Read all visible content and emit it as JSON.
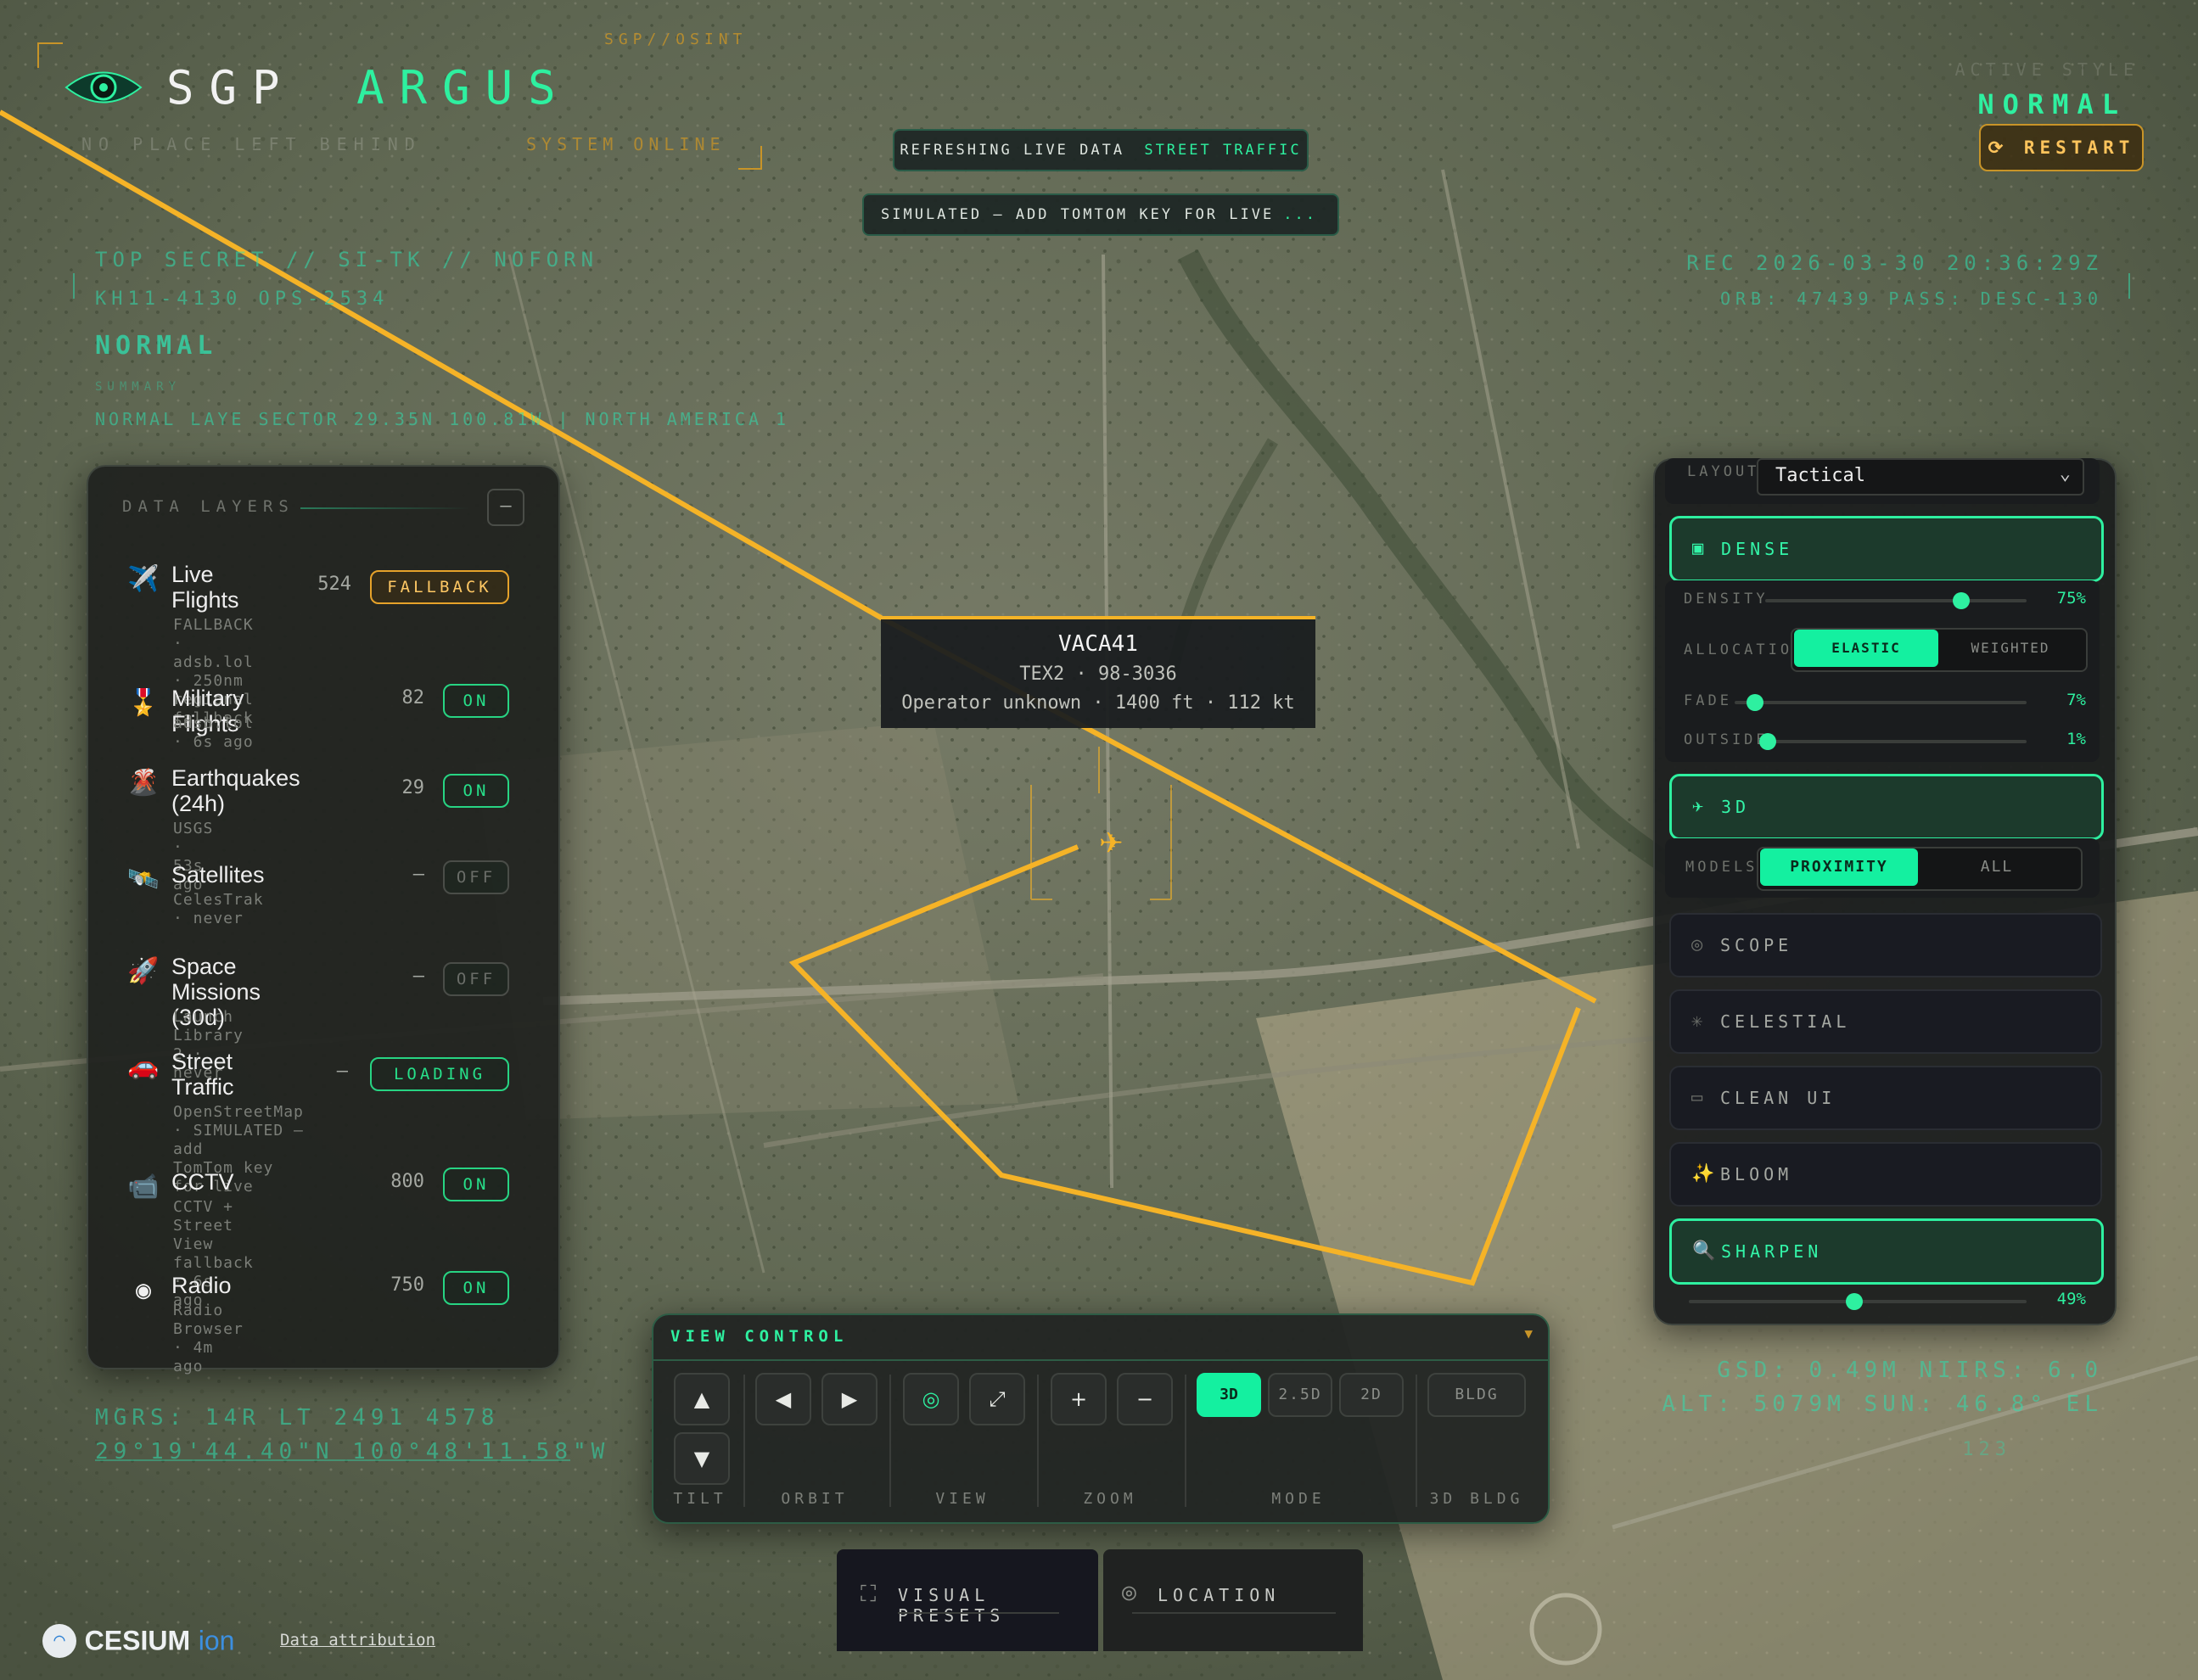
{
  "app": {
    "brand_left": "SGP",
    "brand_right": "ARGUS",
    "top_center_tag": "SGP//OSINT",
    "subtitle_faded": "NO PLACE LEFT BEHIND",
    "system_status": "SYSTEM ONLINE"
  },
  "status_right": {
    "faded_label": "ACTIVE STYLE",
    "mode": "NORMAL",
    "restart_label": "RESTART"
  },
  "banners": {
    "refresh_prefix": "REFRESHING LIVE DATA",
    "refresh_highlight": "STREET TRAFFIC",
    "simulated_text": "SIMULATED — ADD TOMTOM KEY FOR LIVE",
    "simulated_dots": "..."
  },
  "hud": {
    "classification": "TOP SECRET // SI-TK // NOFORN",
    "kh_line": "KH11-4130 OPS-2534",
    "mode": "NORMAL",
    "summary_label": "SUMMARY",
    "sector_line": "NORMAL LAYE SECTOR 29.35N 100.81W | NORTH AMERICA 1",
    "rec_line": "REC 2026-03-30 20:36:29Z",
    "orb_line": "ORB: 47439 PASS: DESC-130",
    "mgrs_line": "MGRS: 14R LT 2491 4578",
    "coords_line": "29°19'44.40\"N 100°48'11.58\"W",
    "gsd_line": "GSD: 0.49M NIIRS: 6.0",
    "alt_line": "ALT: 5079M SUN: 46.8° EL",
    "small_right": "123"
  },
  "data_layers": {
    "title": "DATA LAYERS",
    "collapse_label": "–",
    "items": [
      {
        "icon": "✈️",
        "name": "Live\nFlights",
        "count": "524",
        "state": "FALLBACK",
        "sub": "FALLBACK · adsb.lol · 250nm\nregional fallback"
      },
      {
        "icon": "🎖️",
        "name": "Military Flights",
        "count": "82",
        "state": "ON",
        "sub": "adsb.lol · 6s ago"
      },
      {
        "icon": "🌋",
        "name": "Earthquakes\n(24h)",
        "count": "29",
        "state": "ON",
        "sub": "USGS · 53s ago"
      },
      {
        "icon": "🛰️",
        "name": "Satellites",
        "count": "—",
        "state": "OFF",
        "sub": "CelesTrak · never"
      },
      {
        "icon": "🚀",
        "name": "Space Missions\n(30d)",
        "count": "—",
        "state": "OFF",
        "sub": "Launch Library 2 · never"
      },
      {
        "icon": "🚗",
        "name": "Street\nTraffic",
        "count": "—",
        "state": "LOADING",
        "sub": "OpenStreetMap · SIMULATED — add\nTomTom key for live"
      },
      {
        "icon": "📹",
        "name": "CCTV",
        "count": "800",
        "state": "ON",
        "sub": "CCTV + Street View fallback · 6s\nago"
      },
      {
        "icon": "◉",
        "name": "Radio",
        "count": "750",
        "state": "ON",
        "sub": "Radio Browser · 4m ago"
      }
    ]
  },
  "tooltip": {
    "callsign": "VACA41",
    "reg_line": "TEX2 · 98-3036",
    "detail_line": "Operator unknown · 1400 ft · 112 kt"
  },
  "right_panel": {
    "layout_label": "LAYOUT",
    "layout_value": "Tactical",
    "dense_label": "DENSE",
    "density_label": "DENSITY",
    "density_value": "75%",
    "density": 0.75,
    "allocation_label": "ALLOCATION",
    "allocation_options": [
      "ELASTIC",
      "WEIGHTED"
    ],
    "allocation_selected": "ELASTIC",
    "fade_label": "FADE",
    "fade_value": "7%",
    "fade": 0.07,
    "outside_label": "OUTSIDE",
    "outside_value": "1%",
    "outside": 0.01,
    "three_d_label": "3D",
    "models_label": "MODELS",
    "models_options": [
      "PROXIMITY",
      "ALL"
    ],
    "models_selected": "PROXIMITY",
    "scope_label": "SCOPE",
    "celestial_label": "CELESTIAL",
    "clean_ui_label": "CLEAN UI",
    "bloom_label": "BLOOM",
    "sharpen_label": "SHARPEN",
    "sharpen_value": "49%",
    "sharpen": 0.49
  },
  "view_control": {
    "title": "VIEW CONTROL",
    "groups": {
      "tilt": "TILT",
      "orbit": "ORBIT",
      "view": "VIEW",
      "zoom": "ZOOM",
      "mode": "MODE",
      "bldg": "3D BLDG"
    },
    "mode_options": [
      "3D",
      "2.5D",
      "2D"
    ],
    "mode_selected": "3D",
    "bldg_label": "BLDG"
  },
  "bottom_tabs": {
    "visual_presets": "VISUAL PRESETS",
    "location": "LOCATION"
  },
  "attribution": {
    "cesium": "CESIUM",
    "ion": "ion",
    "link": "Data attribution"
  },
  "colors": {
    "accent_green": "#2ef0a0",
    "hud_cyan": "#2fe0b0",
    "flight_path": "#f5b327",
    "warning": "#e6a22a",
    "panel_bg": "#202220"
  }
}
